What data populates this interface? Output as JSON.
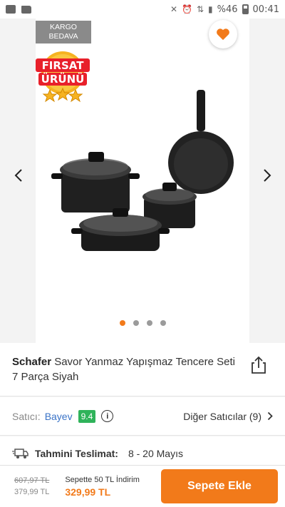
{
  "status_bar": {
    "signal_text": "%46",
    "time": "00:41"
  },
  "gallery": {
    "badge_cargo_line1": "KARGO",
    "badge_cargo_line2": "BEDAVA",
    "badge_deal_line1": "FIRSAT",
    "badge_deal_line2": "ÜRÜNÜ",
    "page_count": 4,
    "active_page": 1
  },
  "product": {
    "brand": "Schafer",
    "name": "Savor Yanmaz Yapışmaz Tencere Seti 7 Parça Siyah"
  },
  "seller": {
    "label": "Satıcı:",
    "name": "Bayev",
    "score": "9.4",
    "other_sellers": "Diğer Satıcılar (9)"
  },
  "delivery": {
    "label": "Tahmini Teslimat:",
    "value": "8 - 20 Mayıs"
  },
  "bottom": {
    "old_price": "607,97 TL",
    "price": "379,99 TL",
    "promo": "Sepette 50 TL İndirim",
    "promo_price": "329,99 TL",
    "add_to_cart": "Sepete Ekle"
  },
  "colors": {
    "accent": "#f27a1a",
    "seller_link": "#3a73c7",
    "score_bg": "#2fb35a"
  }
}
